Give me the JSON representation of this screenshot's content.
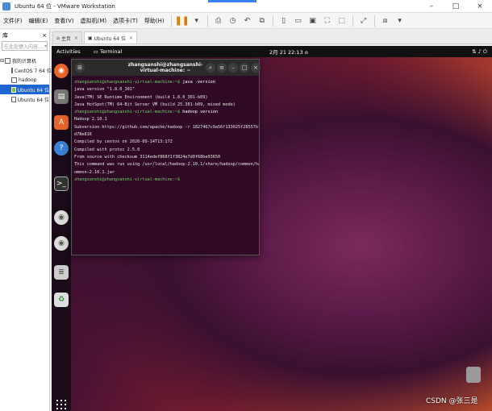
{
  "window": {
    "title": "Ubuntu 64 位 - VMware Workstation"
  },
  "menu": {
    "items": [
      "文件(F)",
      "编辑(E)",
      "查看(V)",
      "虚拟机(M)",
      "选项卡(T)",
      "帮助(H)"
    ]
  },
  "library": {
    "title": "库",
    "close": "×",
    "search_placeholder": "在此处键入内容...",
    "root": "我的计算机",
    "vms": [
      "CentOS 7 64 位",
      "hadoop",
      "Ubuntu 64 位",
      "Ubuntu 64 位"
    ]
  },
  "tabs": [
    {
      "label": "主页"
    },
    {
      "label": "Ubuntu 64 位"
    }
  ],
  "gnome": {
    "activities": "Activities",
    "app": "Terminal",
    "clock": "2月 21 22:13"
  },
  "terminal": {
    "title": "zhangsanshi@zhangsanshi-virtual-machine: ~",
    "prompt": "zhangsanshi@zhangsanshi-virtual-machine:~$",
    "cmd1": " java -version",
    "java_out": "java version \"1.8.0_301\"\nJava(TM) SE Runtime Environment (build 1.8.0_301-b09)\nJava HotSpot(TM) 64-Bit Server VM (build 25.301-b09, mixed mode)",
    "cmd2": " hadoop version",
    "hadoop_out": "Hadoop 2.10.1\nSubversion https://github.com/apache/hadoop -r 1827467c9a56f133025f28557bfc2c562\nd78e816\nCompiled by centos on 2020-09-14T13:17Z\nCompiled with protoc 2.5.0\nFrom source with checksum 3114edef868f1f3824e7d0f68be03650\nThis command was run using /usr/local/hadoop-2.10.1/share/hadoop/common/hadoop-c\nommon-2.10.1.jar",
    "cmd3": ""
  },
  "watermark": "CSDN @张三是"
}
